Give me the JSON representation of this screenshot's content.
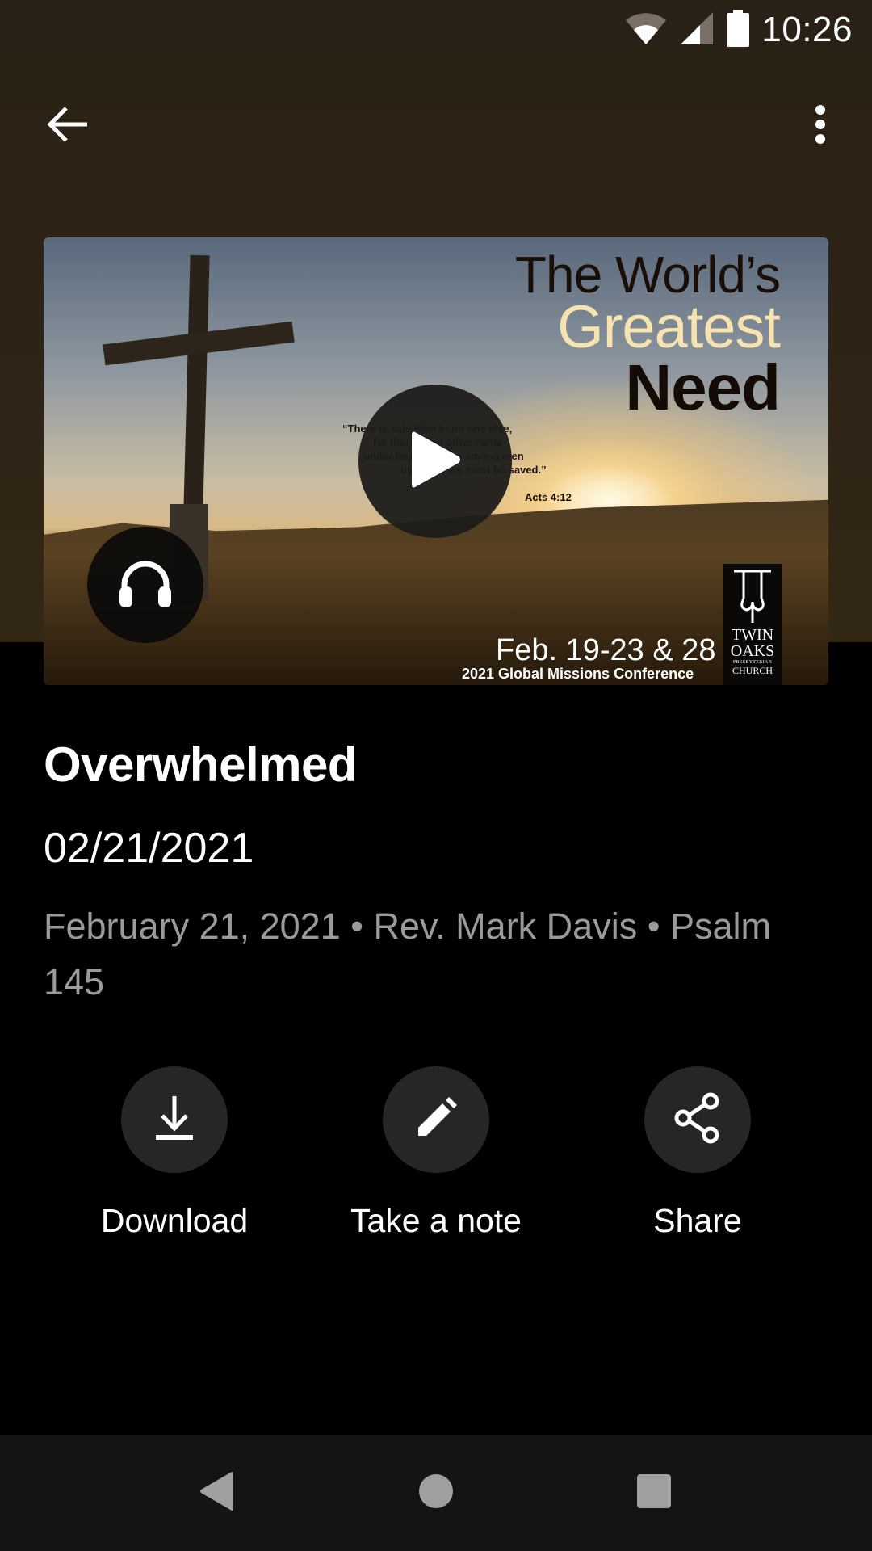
{
  "status_bar": {
    "time": "10:26",
    "icons": [
      "wifi-icon",
      "cellular-signal-icon",
      "battery-icon"
    ]
  },
  "app_bar": {
    "back_icon": "arrow-back-icon",
    "more_icon": "more-vert-icon"
  },
  "thumbnail": {
    "title_line1": "The World’s",
    "title_line2": "Greatest",
    "title_line3": "Need",
    "verse_lines": [
      "“There is salvation in no one else,",
      "for there is no other name",
      "under heaven given among men",
      "by which we must be saved.”"
    ],
    "verse_ref": "Acts 4:12",
    "event_dates": "Feb. 19-23 & 28",
    "event_name": "2021 Global Missions Conference",
    "church_logo": {
      "line1": "TWIN",
      "line2": "OAKS",
      "line3": "PRESBYTERIAN",
      "line4": "CHURCH"
    },
    "play_icon": "play-icon",
    "audio_icon": "headphones-icon"
  },
  "sermon": {
    "title": "Overwhelmed",
    "date_short": "02/21/2021",
    "meta": "February 21, 2021 • Rev. Mark Davis • Psalm 145"
  },
  "actions": [
    {
      "label": "Download",
      "icon": "download-icon"
    },
    {
      "label": "Take a note",
      "icon": "edit-icon"
    },
    {
      "label": "Share",
      "icon": "share-icon"
    }
  ],
  "nav_bar": {
    "back": "nav-back-icon",
    "home": "nav-home-icon",
    "recents": "nav-recents-icon"
  },
  "colors": {
    "hero_background": "#2f2416",
    "page_background": "#000000",
    "action_circle": "#262626",
    "meta_text": "#9a9a9a",
    "nav_bar": "#131416"
  }
}
